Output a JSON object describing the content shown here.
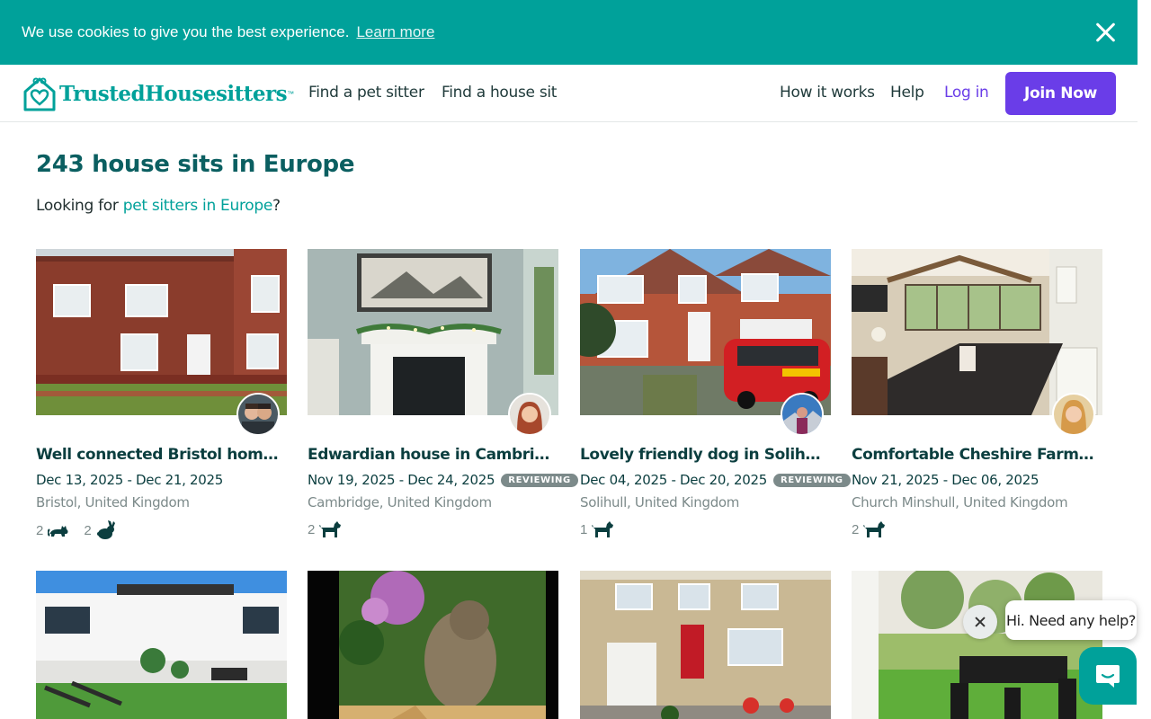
{
  "cookie": {
    "message": "We use cookies to give you the best experience.",
    "learn_more": "Learn more"
  },
  "header": {
    "brand": "TrustedHousesitters",
    "trademark": "™",
    "nav": {
      "find_pet_sitter": "Find a pet sitter",
      "find_house_sit": "Find a house sit",
      "how_it_works": "How it works",
      "help": "Help",
      "log_in": "Log in",
      "join_now": "Join Now"
    }
  },
  "main": {
    "title": "243 house sits in Europe",
    "looking_prefix": "Looking for ",
    "looking_link": "pet sitters in Europe",
    "looking_suffix": "?"
  },
  "listings": [
    {
      "title": "Well connected Bristol home with dogs",
      "dates": "Dec 13, 2025 - Dec 21, 2025",
      "status": "",
      "location": "Bristol, United Kingdom",
      "pets": [
        {
          "count": "2",
          "icon": "cat-icon"
        },
        {
          "count": "2",
          "icon": "rabbit-icon"
        }
      ]
    },
    {
      "title": "Edwardian house in Cambridge with dogs",
      "dates": "Nov 19, 2025 - Dec 24, 2025",
      "status": "REVIEWING",
      "location": "Cambridge, United Kingdom",
      "pets": [
        {
          "count": "2",
          "icon": "dog-icon"
        }
      ]
    },
    {
      "title": "Lovely friendly dog in Solihull needs a sitter",
      "dates": "Dec 04, 2025 - Dec 20, 2025",
      "status": "REVIEWING",
      "location": "Solihull, United Kingdom",
      "pets": [
        {
          "count": "1",
          "icon": "dog-icon"
        }
      ]
    },
    {
      "title": "Comfortable Cheshire Farmhouse with dogs",
      "dates": "Nov 21, 2025 - Dec 06, 2025",
      "status": "",
      "location": "Church Minshull, United Kingdom",
      "pets": [
        {
          "count": "2",
          "icon": "dog-icon"
        }
      ]
    }
  ],
  "chat": {
    "greeting": "Hi. Need any help?"
  },
  "colors": {
    "brand_teal": "#00a19a",
    "dark_teal": "#0b5f61",
    "purple": "#6a3de8"
  }
}
